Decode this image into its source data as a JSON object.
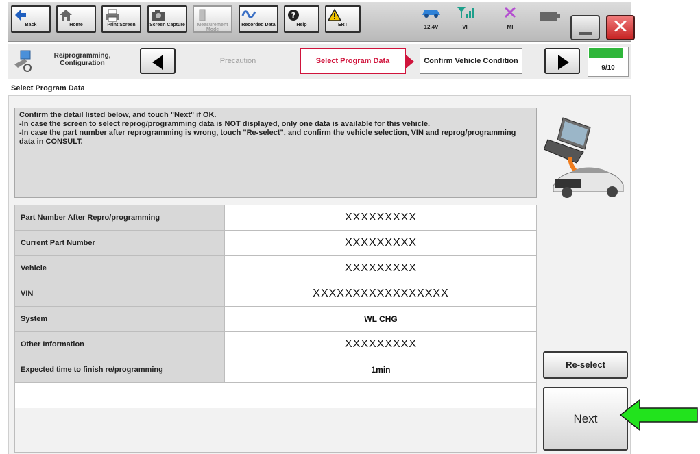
{
  "toolbar": {
    "buttons": [
      {
        "label": "Back",
        "icon": "back-arrow-icon",
        "enabled": true
      },
      {
        "label": "Home",
        "icon": "home-icon",
        "enabled": true
      },
      {
        "label": "Print Screen",
        "icon": "printer-icon",
        "enabled": true
      },
      {
        "label": "Screen Capture",
        "icon": "camera-icon",
        "enabled": true
      },
      {
        "label": "Measurement Mode",
        "icon": "meter-icon",
        "enabled": false
      },
      {
        "label": "Recorded Data",
        "icon": "recorded-data-icon",
        "enabled": true
      },
      {
        "label": "Help",
        "icon": "help-icon",
        "enabled": true
      },
      {
        "label": "ERT",
        "icon": "warning-icon",
        "enabled": true
      }
    ],
    "status": {
      "voltage": "12.4V",
      "vi_label": "VI",
      "mi_label": "MI"
    }
  },
  "navigation": {
    "app_mode": "Re/programming, Configuration",
    "steps": {
      "precaution": "Precaution",
      "current": "Select Program Data",
      "next": "Confirm Vehicle Condition"
    },
    "progress": {
      "text": "9/10",
      "fraction": 0.9
    }
  },
  "page_title": "Select Program Data",
  "instructions": [
    "Confirm the detail listed below, and touch \"Next\" if OK.",
    "-In case the screen to select reprog/programming data is NOT displayed, only one data is available for this vehicle.",
    "-In case the part number after reprogramming is wrong, touch \"Re-select\", and confirm the vehicle selection, VIN and reprog/programming data in CONSULT."
  ],
  "table": {
    "rows": [
      {
        "label": "Part Number After Repro/programming",
        "value": "XXXXXXXXX"
      },
      {
        "label": "Current Part Number",
        "value": "XXXXXXXXX"
      },
      {
        "label": "Vehicle",
        "value": "XXXXXXXXX"
      },
      {
        "label": "VIN",
        "value": "XXXXXXXXXXXXXXXXX"
      },
      {
        "label": "System",
        "value": "WL CHG"
      },
      {
        "label": "Other Information",
        "value": "XXXXXXXXX"
      },
      {
        "label": "Expected time to finish re/programming",
        "value": "1min"
      }
    ]
  },
  "actions": {
    "reselect_label": "Re-select",
    "next_label": "Next"
  },
  "colors": {
    "accent_red": "#d0143c",
    "progress_green": "#2fb63a",
    "pointer_green": "#22e31d"
  }
}
